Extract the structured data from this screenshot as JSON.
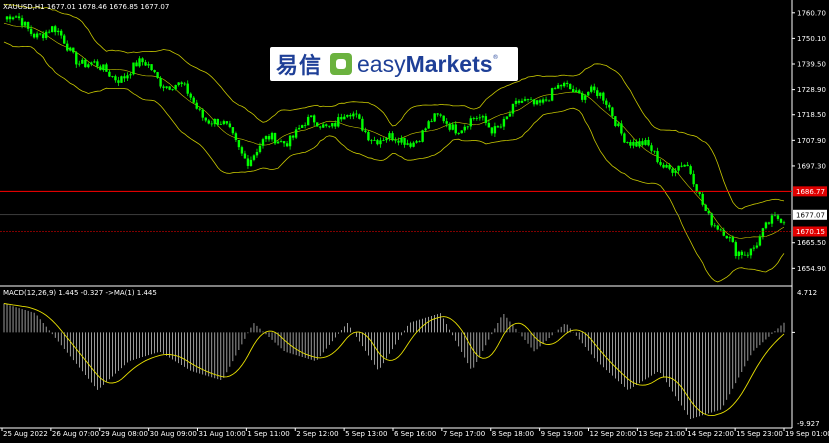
{
  "header": {
    "symbol_label": "XAUUSD,H1",
    "ohlc": "1677.01 1678.46 1676.85 1677.07"
  },
  "logo": {
    "chinese": "易信",
    "english_light": "easy",
    "english_bold": "Markets",
    "registered": "®"
  },
  "macd_panel": {
    "label": "MACD(12,26,9) 1.445 -0.327 ->MA(1) 1.445",
    "top_value": "4.712",
    "bottom_value": "-9.927"
  },
  "price_axis": {
    "ticks": [
      "1760.70",
      "1750.10",
      "1739.50",
      "1728.90",
      "1718.50",
      "1707.90",
      "1697.30",
      "1665.50",
      "1654.90"
    ],
    "current_price": "1677.07",
    "red_tag_upper": "1686.77",
    "red_tag_lower": "1670.15"
  },
  "time_axis": {
    "ticks": [
      "25 Aug 2022",
      "26 Aug 07:00",
      "29 Aug 08:00",
      "30 Aug 09:00",
      "31 Aug 10:00",
      "1 Sep 11:00",
      "2 Sep 12:00",
      "5 Sep 13:00",
      "6 Sep 16:00",
      "7 Sep 17:00",
      "8 Sep 18:00",
      "9 Sep 19:00",
      "12 Sep 20:00",
      "13 Sep 21:00",
      "14 Sep 22:00",
      "15 Sep 23:00",
      "19 Sep 01:00"
    ]
  },
  "colors": {
    "background": "#000000",
    "candle": "#00ff00",
    "bands": "#c8c800",
    "signal": "#e8e000",
    "histogram": "#ffffff",
    "red_lines": "#ff0000",
    "grid_separator": "#ffffff"
  },
  "chart_data": {
    "type": "line",
    "instrument": "XAUUSD",
    "timeframe": "H1",
    "ylim": [
      1648,
      1766
    ],
    "x": [
      "25 Aug 2022",
      "26 Aug 07:00",
      "29 Aug 08:00",
      "30 Aug 09:00",
      "31 Aug 10:00",
      "1 Sep 11:00",
      "2 Sep 12:00",
      "5 Sep 13:00",
      "6 Sep 16:00",
      "7 Sep 17:00",
      "8 Sep 18:00",
      "9 Sep 19:00",
      "12 Sep 20:00",
      "13 Sep 21:00",
      "14 Sep 22:00",
      "15 Sep 23:00",
      "19 Sep 01:00"
    ],
    "series": [
      {
        "values": [
          1758,
          1752,
          1735,
          1738,
          1722,
          1702,
          1712,
          1718,
          1706,
          1716,
          1714,
          1726,
          1730,
          1705,
          1695,
          1660,
          1676
        ]
      }
    ],
    "horizontal_lines": [
      1686.77,
      1670.15
    ],
    "macd_ylim": [
      -9.927,
      4.712
    ],
    "macd_hist": [
      3,
      2,
      -2,
      -6,
      -3,
      -2,
      -4,
      -5,
      1,
      -2,
      -3,
      1,
      -4,
      1,
      2,
      -4,
      2,
      -2,
      1,
      -3,
      -6,
      -4,
      -9,
      -8,
      -2,
      1
    ]
  }
}
